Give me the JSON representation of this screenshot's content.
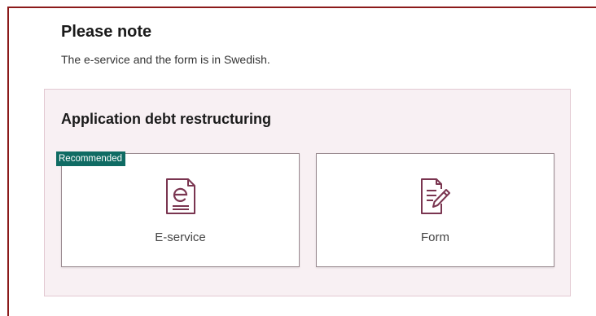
{
  "note": {
    "title": "Please note",
    "text": "The e-service and the form is in Swedish."
  },
  "application": {
    "title": "Application debt restructuring",
    "options": [
      {
        "badge": "Recommended",
        "label": "E-service",
        "icon": "e-document-icon"
      },
      {
        "label": "Form",
        "icon": "form-pen-icon"
      }
    ]
  },
  "colors": {
    "brand": "#8b1a1a",
    "icon": "#7a3550",
    "badge": "#0f6b63",
    "panel_bg": "#f8f0f3"
  }
}
